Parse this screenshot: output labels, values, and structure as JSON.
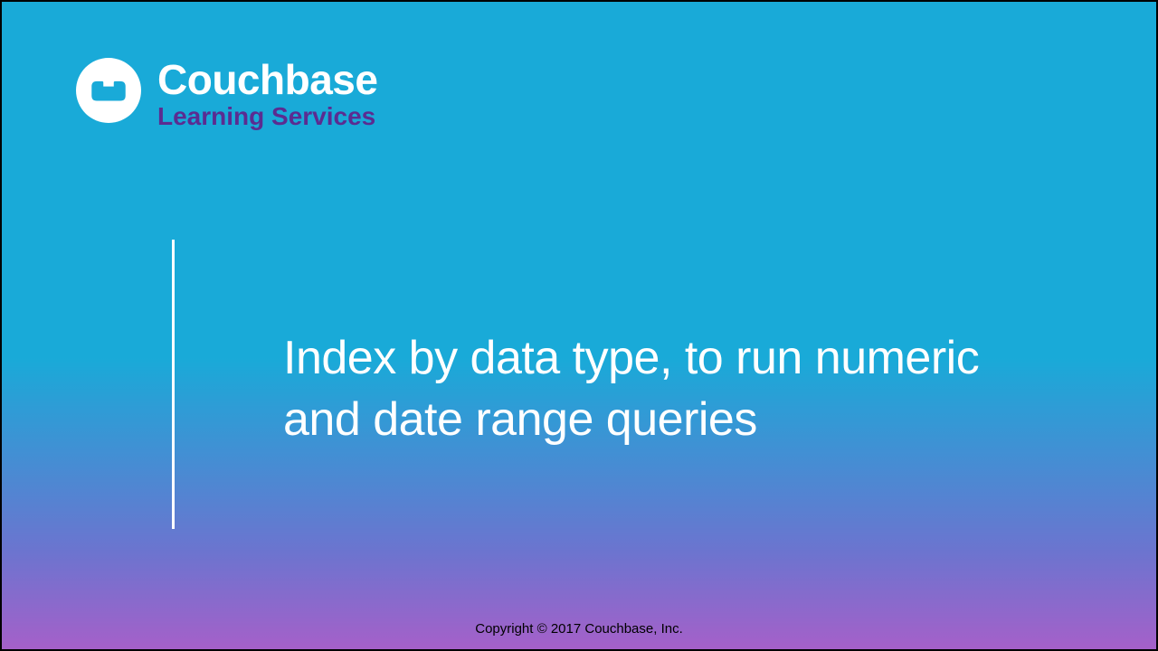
{
  "brand": {
    "name": "Couchbase",
    "subline": "Learning Services"
  },
  "slide": {
    "title": "Index by data type, to run numeric and date range queries"
  },
  "footer": {
    "copyright": "Copyright © 2017  Couchbase, Inc."
  }
}
